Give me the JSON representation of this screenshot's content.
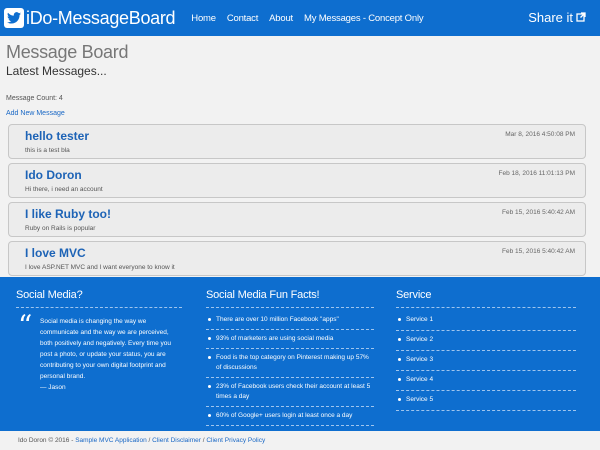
{
  "navbar": {
    "brand": "iDo-MessageBoard",
    "links": [
      "Home",
      "Contact",
      "About",
      "My Messages - Concept Only"
    ],
    "share": "Share it"
  },
  "main": {
    "title": "Message Board",
    "subtitle": "Latest Messages...",
    "count": "Message Count: 4",
    "add_link": "Add New Message",
    "messages": [
      {
        "title": "hello tester",
        "body": "this is a test bla",
        "date": "Mar 8, 2016 4:50:08 PM"
      },
      {
        "title": "Ido Doron",
        "body": "Hi there, i need an account",
        "date": "Feb 18, 2016 11:01:13 PM"
      },
      {
        "title": "I like Ruby too!",
        "body": "Ruby on Rails is popular",
        "date": "Feb 15, 2016 5:40:42 AM"
      },
      {
        "title": "I love MVC",
        "body": "I love ASP.NET MVC and I want everyone to know it",
        "date": "Feb 15, 2016 5:40:42 AM"
      }
    ]
  },
  "footer": {
    "social": {
      "heading": "Social Media?",
      "quote": "Social media is changing the way we communicate and the way we are perceived, both positively and negatively. Every time you post a photo, or update your status, you are contributing to your own digital footprint and personal brand.",
      "author": "— Jason"
    },
    "facts": {
      "heading": "Social Media Fun Facts!",
      "items": [
        "There are over 10 million Facebook \"apps\"",
        "93% of marketers are using social media",
        "Food is the top category on Pinterest making up 57% of discussions",
        "23% of Facebook users check their account at least 5 times a day",
        "60% of Google+ users login at least once a day"
      ]
    },
    "service": {
      "heading": "Service",
      "items": [
        "Service 1",
        "Service 2",
        "Service 3",
        "Service 4",
        "Service 5"
      ]
    }
  },
  "bottom": {
    "copyright": "Ido Doron © 2016 - ",
    "links": [
      "Sample MVC Application",
      "Client Disclaimer",
      "Client Privacy Policy"
    ],
    "separator": " / "
  },
  "colors": {
    "brand": "#0e6ecf",
    "link": "#1a68c5",
    "title": "#1d63b6"
  },
  "icons": {
    "brand": "twitter-bird-icon",
    "share": "external-link-icon",
    "quote": "quote-icon"
  }
}
